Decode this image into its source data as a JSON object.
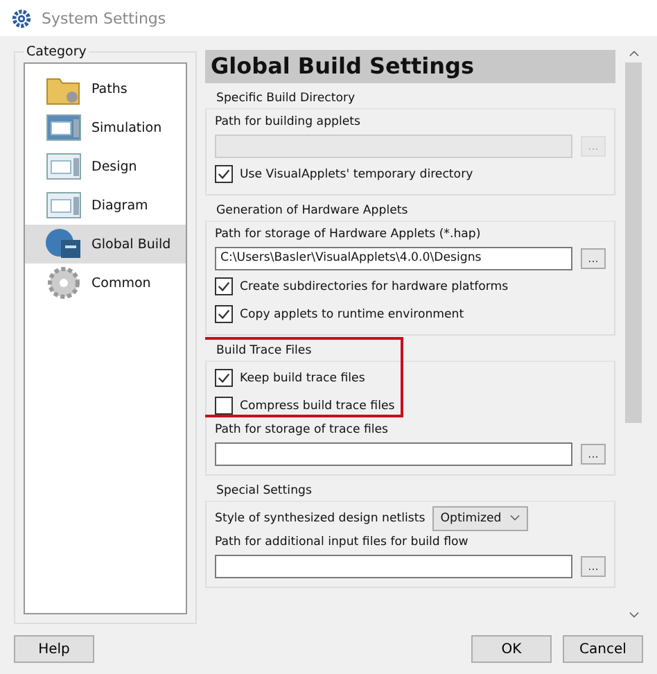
{
  "window": {
    "title": "System Settings"
  },
  "category": {
    "title": "Category",
    "items": [
      {
        "label": "Paths",
        "selected": false
      },
      {
        "label": "Simulation",
        "selected": false
      },
      {
        "label": "Design",
        "selected": false
      },
      {
        "label": "Diagram",
        "selected": false
      },
      {
        "label": "Global Build",
        "selected": true
      },
      {
        "label": "Common",
        "selected": false
      }
    ]
  },
  "heading": "Global Build Settings",
  "groups": [
    {
      "title": "Specific Build Directory",
      "highlighted": false,
      "rows": [
        {
          "kind": "label",
          "text": "Path for building applets"
        },
        {
          "kind": "path",
          "disabled": true,
          "browse": "..."
        },
        {
          "kind": "checkbox",
          "label": "Use VisualApplets' temporary directory",
          "checked": true
        }
      ]
    },
    {
      "title": "Generation of Hardware Applets",
      "highlighted": false,
      "rows": [
        {
          "kind": "label",
          "text": "Path for storage of Hardware Applets (*.hap)"
        },
        {
          "kind": "path",
          "disabled": false,
          "value": "C:\\Users\\Basler\\VisualApplets\\4.0.0\\Designs",
          "browse": "..."
        },
        {
          "kind": "checkbox",
          "label": "Create subdirectories for hardware platforms",
          "checked": true
        },
        {
          "kind": "checkbox",
          "label": "Copy applets to runtime environment",
          "checked": true
        }
      ]
    },
    {
      "title": "Build Trace Files",
      "highlighted": true,
      "rows": [
        {
          "kind": "checkbox",
          "label": "Keep build trace files",
          "checked": true
        },
        {
          "kind": "checkbox",
          "label": "Compress build trace files",
          "checked": false
        },
        {
          "kind": "label",
          "text": "Path for storage of trace files"
        },
        {
          "kind": "path",
          "disabled": false,
          "browse": "..."
        }
      ]
    },
    {
      "title": "Special Settings",
      "highlighted": false,
      "rows": [
        {
          "kind": "combo",
          "label": "Style of synthesized design netlists",
          "value": "Optimized"
        },
        {
          "kind": "label",
          "text": "Path for additional input files for build flow"
        },
        {
          "kind": "path",
          "disabled": false,
          "browse": "..."
        }
      ]
    }
  ],
  "buttons": {
    "help": "Help",
    "ok": "OK",
    "cancel": "Cancel"
  }
}
